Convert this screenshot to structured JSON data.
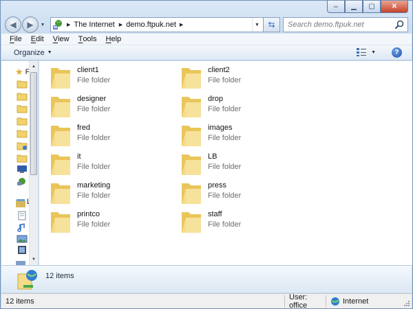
{
  "window": {
    "caption_buttons": [
      "back-forward",
      "minimize",
      "maximize",
      "close"
    ]
  },
  "address": {
    "crumbs": [
      "The Internet",
      "demo.ftpuk.net"
    ]
  },
  "search": {
    "placeholder": "Search demo.ftpuk.net"
  },
  "menu": {
    "items": [
      {
        "key": "F",
        "rest": "ile"
      },
      {
        "key": "E",
        "rest": "dit"
      },
      {
        "key": "V",
        "rest": "iew"
      },
      {
        "key": "T",
        "rest": "ools"
      },
      {
        "key": "H",
        "rest": "elp"
      }
    ]
  },
  "command": {
    "organize": "Organize"
  },
  "nav_pane": {
    "favorites_letter": "F"
  },
  "items": [
    {
      "name": "client1",
      "type": "File folder"
    },
    {
      "name": "client2",
      "type": "File folder"
    },
    {
      "name": "designer",
      "type": "File folder"
    },
    {
      "name": "drop",
      "type": "File folder"
    },
    {
      "name": "fred",
      "type": "File folder"
    },
    {
      "name": "images",
      "type": "File folder"
    },
    {
      "name": "it",
      "type": "File folder"
    },
    {
      "name": "LB",
      "type": "File folder"
    },
    {
      "name": "marketing",
      "type": "File folder"
    },
    {
      "name": "press",
      "type": "File folder"
    },
    {
      "name": "printco",
      "type": "File folder"
    },
    {
      "name": "staff",
      "type": "File folder"
    }
  ],
  "details": {
    "count": "12 items"
  },
  "status": {
    "count": "12 items",
    "user": "User: office",
    "zone": "Internet"
  },
  "colors": {
    "folder": "#f2d36b",
    "accent": "#2a6cc0"
  }
}
